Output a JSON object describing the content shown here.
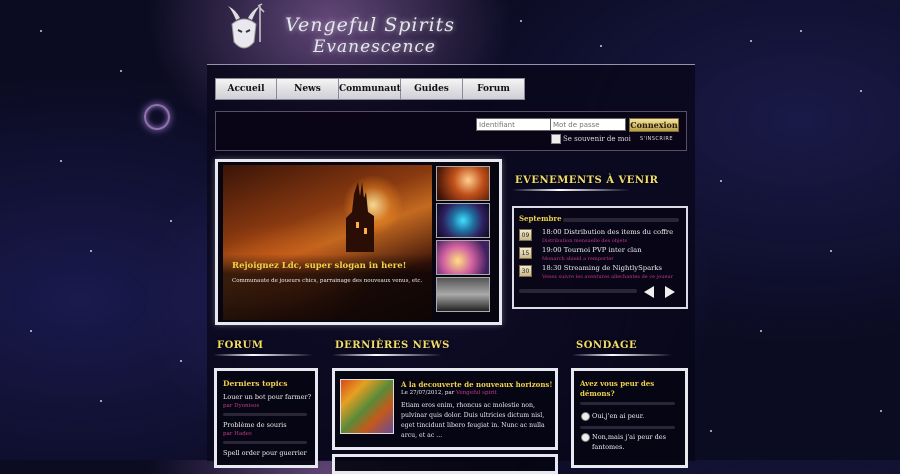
{
  "header": {
    "title": "Vengeful Spirits",
    "subtitle": "Evanescence"
  },
  "nav": {
    "items": [
      "Accueil",
      "News",
      "Communaute",
      "Guides",
      "Forum"
    ]
  },
  "login": {
    "username_placeholder": "Identifiant",
    "password_placeholder": "Mot de passe",
    "remember_label": "Se souvenir de moi",
    "connect_label": "Connexion",
    "register_label": "S'INSCRIRE"
  },
  "slider": {
    "title": "Rejoignez Ldc, super slogan in here!",
    "description": "Communaute de joueurs chics, parrainage des nouveaux venus, etc."
  },
  "events": {
    "heading": "EVENEMENTS À VENIR",
    "month": "Septembre",
    "items": [
      {
        "day": "09",
        "title": "18:00 Distribution des items du coffre",
        "sub": "Distribution mensuelle des objets"
      },
      {
        "day": "15",
        "title": "19:00 Tournoi PVP inter clan",
        "sub": "Monarch shield a remporter"
      },
      {
        "day": "30",
        "title": "18:30 Streaming de NightlySparks",
        "sub": "Venez suivre les aventures allechantes de ce joueur"
      }
    ]
  },
  "forum": {
    "heading": "FORUM",
    "subheading": "Derniers topics",
    "topics": [
      {
        "title": "Louer un bot pour farmer?",
        "author": "par Dyonisos"
      },
      {
        "title": "Problème de souris",
        "author": "par Hades"
      },
      {
        "title": "Spell order pour guerrier",
        "author": ""
      }
    ]
  },
  "news": {
    "heading": "DERNIÈRES NEWS",
    "title": "A la decouverte de nouveaux horizons!",
    "meta_prefix": "Le 27/07/2012, par",
    "meta_author": "Vengeful spirit",
    "body_lines": [
      "Etiam eros enim, rhoncus ac molestie non,",
      "pulvinar quis dolor. Duis ultricies dictum nisl,",
      "eget tincidunt libero feugiat in. Nunc ac nulla",
      "arcu, et ac ..."
    ]
  },
  "poll": {
    "heading": "SONDAGE",
    "question": "Avez vous peur des démons?",
    "options": [
      "Oui,j'en ai peur.",
      "Non,mais j'ai peur des fantomes."
    ]
  }
}
